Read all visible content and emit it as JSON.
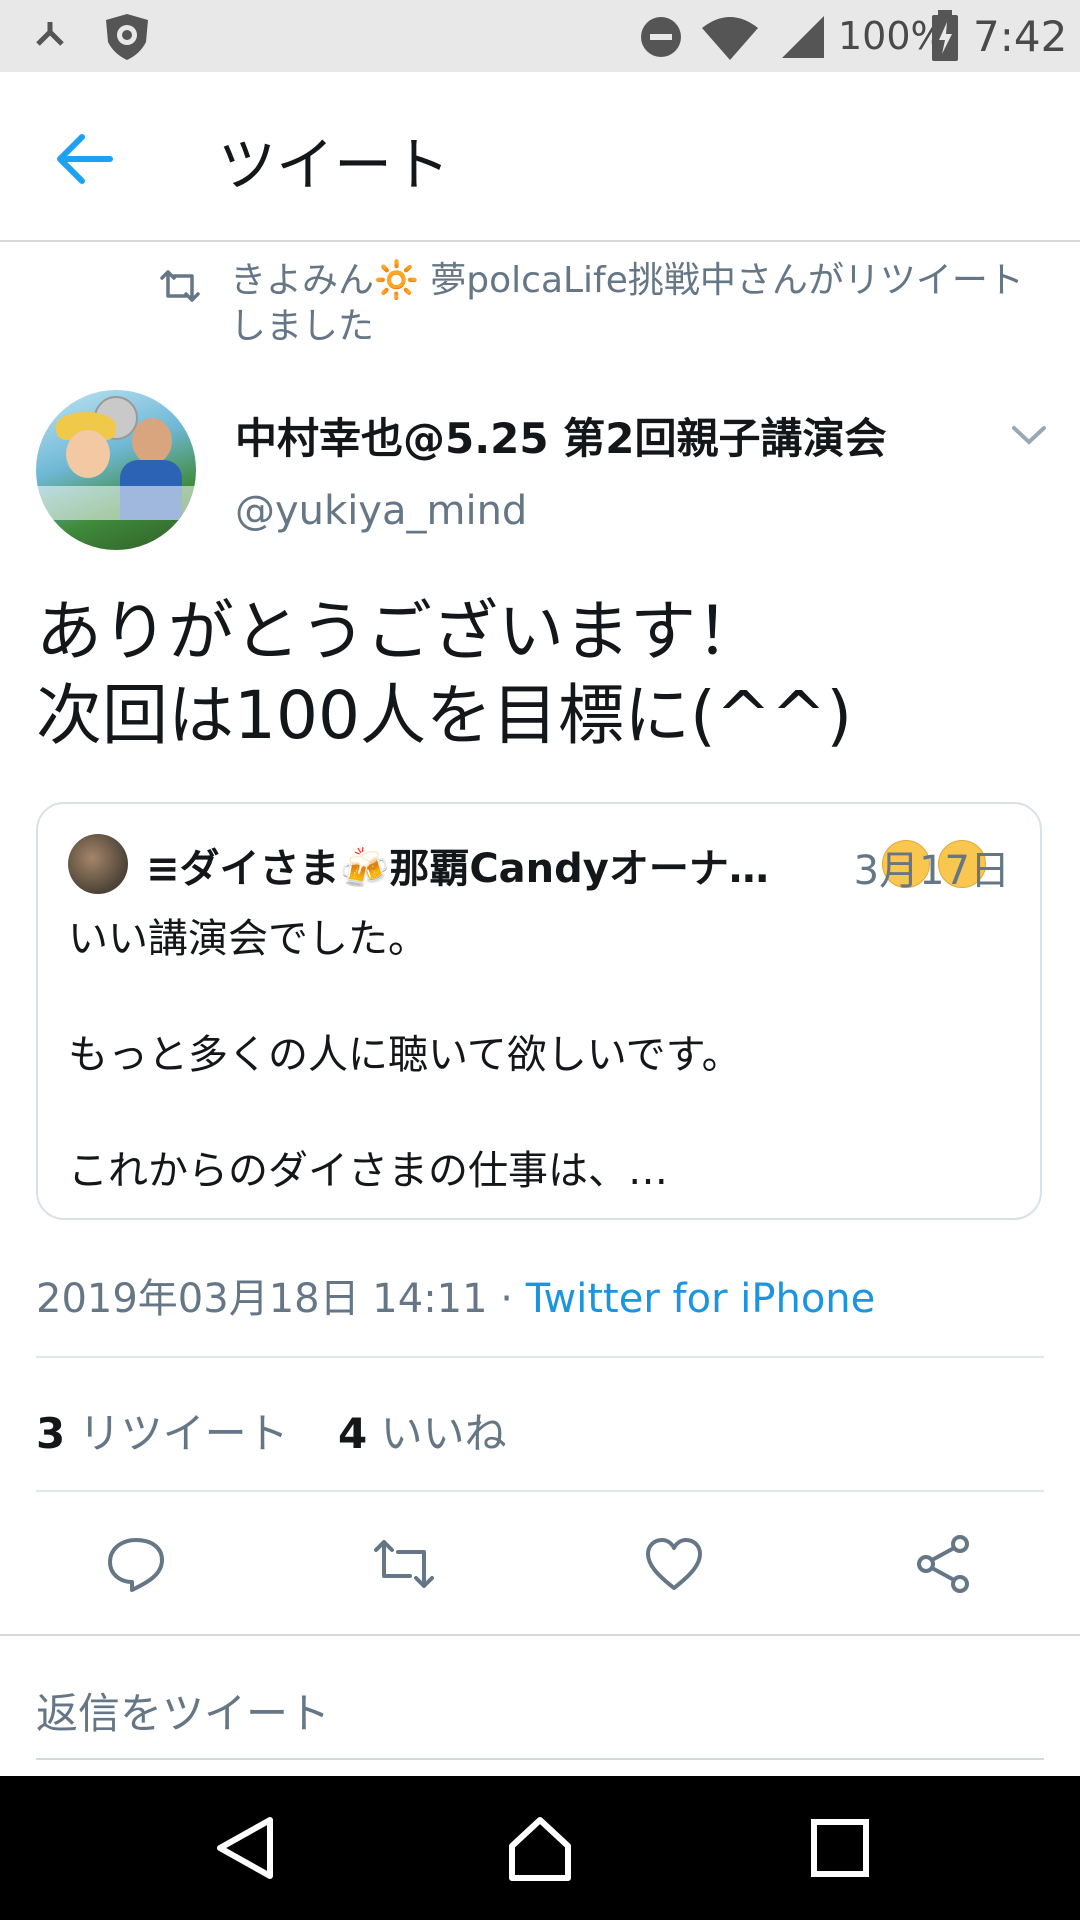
{
  "status_bar": {
    "battery": "100%",
    "time": "7:42",
    "icons": [
      "download-icon",
      "shield-icon",
      "dnd-icon",
      "wifi-icon",
      "signal-icon",
      "battery-icon"
    ]
  },
  "header": {
    "title": "ツイート"
  },
  "retweet": {
    "text": "きよみん🔆 夢polcaLife挑戦中さんがリツイートしました"
  },
  "author": {
    "name": "中村幸也@5.25 第2回親子講演会",
    "handle": "@yukiya_mind"
  },
  "tweet": {
    "text": "ありがとうございます！\n次回は100人を目標に(^^)"
  },
  "quote": {
    "name": "≡ダイさま🍻那覇Candyオーナ…",
    "date": "3月17日",
    "line1": "いい講演会でした。",
    "line2": "もっと多くの人に聴いて欲しいです。",
    "line3": "これからのダイさまの仕事は、…"
  },
  "meta": {
    "timestamp": "2019年03月18日 14:11 · ",
    "source": "Twitter for iPhone"
  },
  "stats": {
    "retweets": "3",
    "retweets_label": "リツイート",
    "likes": "4",
    "likes_label": "いいね"
  },
  "reply": {
    "placeholder": "返信をツイート"
  },
  "colors": {
    "accent": "#1b95e0",
    "muted": "#657786",
    "text": "#14171a"
  }
}
